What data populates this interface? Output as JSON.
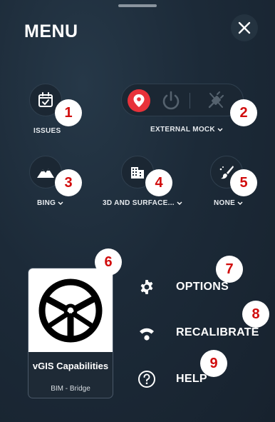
{
  "menu": {
    "title": "MENU",
    "close_icon": "close-icon"
  },
  "quick_actions": {
    "issues": {
      "label": "ISSUES",
      "icon": "calendar-check-icon"
    },
    "mock": {
      "label": "EXTERNAL MOCK",
      "icons": [
        "location-pin-icon",
        "power-icon",
        "cable-icon"
      ],
      "accent": "#e8323a"
    },
    "basemap": {
      "label": "BING",
      "icon": "mountain-icon"
    },
    "buildings": {
      "label": "3D AND SURFACE...",
      "icon": "buildings-icon"
    },
    "style": {
      "label": "NONE",
      "icon": "paint-brush-icon"
    }
  },
  "project_card": {
    "name": "vGIS Capabilities",
    "subtitle": "BIM - Bridge",
    "image_icon": "steering-wheel-icon"
  },
  "menu_items": [
    {
      "label": "OPTIONS",
      "icon": "gear-icon"
    },
    {
      "label": "RECALIBRATE",
      "icon": "wifi-signal-icon"
    },
    {
      "label": "HELP",
      "icon": "help-circle-icon"
    }
  ],
  "annotation_badges": [
    "1",
    "2",
    "3",
    "4",
    "5",
    "6",
    "7",
    "8",
    "9"
  ],
  "badge_color": "#d10c0c"
}
